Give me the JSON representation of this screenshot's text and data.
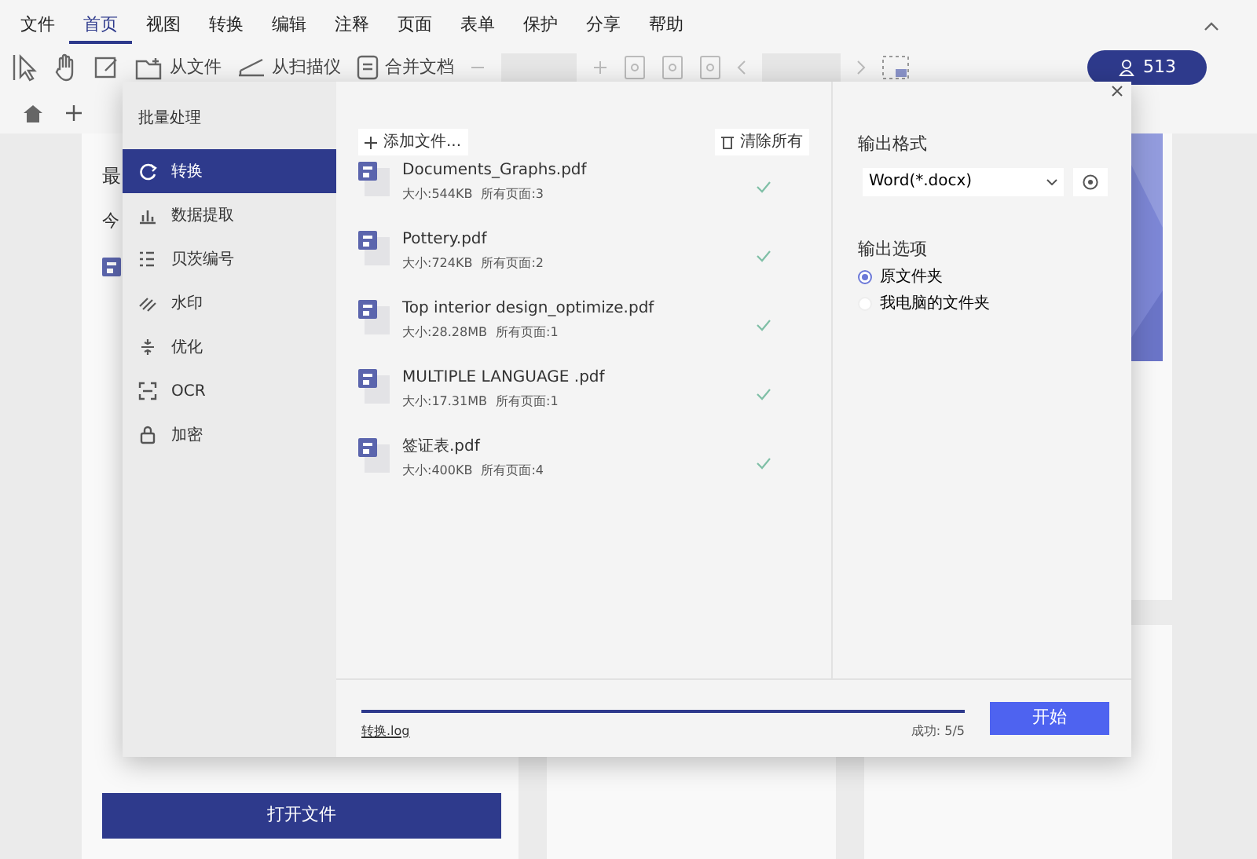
{
  "menu": [
    {
      "label": "文件",
      "selected": false
    },
    {
      "label": "首页",
      "selected": true
    },
    {
      "label": "视图",
      "selected": false
    },
    {
      "label": "转换",
      "selected": false
    },
    {
      "label": "编辑",
      "selected": false
    },
    {
      "label": "注释",
      "selected": false
    },
    {
      "label": "页面",
      "selected": false
    },
    {
      "label": "表单",
      "selected": false
    },
    {
      "label": "保护",
      "selected": false
    },
    {
      "label": "分享",
      "selected": false
    },
    {
      "label": "帮助",
      "selected": false
    }
  ],
  "toolbar": {
    "from_file": "从文件",
    "from_scanner": "从扫描仪",
    "combine": "合并文档",
    "user_count": "513"
  },
  "home": {
    "title_fragment": "最",
    "subtitle_fragment": "今",
    "open_button": "打开文件"
  },
  "dialog": {
    "title": "批量处理",
    "sidebar": [
      {
        "label": "转换",
        "selected": true
      },
      {
        "label": "数据提取",
        "selected": false
      },
      {
        "label": "贝茨编号",
        "selected": false
      },
      {
        "label": "水印",
        "selected": false
      },
      {
        "label": "优化",
        "selected": false
      },
      {
        "label": "OCR",
        "selected": false
      },
      {
        "label": "加密",
        "selected": false
      }
    ],
    "add_files": "添加文件...",
    "clear_all": "清除所有",
    "files": [
      {
        "name": "Documents_Graphs.pdf",
        "size": "大小:544KB",
        "pages": "所有页面:3",
        "done": true
      },
      {
        "name": "Pottery.pdf",
        "size": "大小:724KB",
        "pages": "所有页面:2",
        "done": true
      },
      {
        "name": "Top interior design_optimize.pdf",
        "size": "大小:28.28MB",
        "pages": "所有页面:1",
        "done": true
      },
      {
        "name": "MULTIPLE LANGUAGE .pdf",
        "size": "大小:17.31MB",
        "pages": "所有页面:1",
        "done": true
      },
      {
        "name": "签证表.pdf",
        "size": "大小:400KB",
        "pages": "所有页面:4",
        "done": true
      }
    ],
    "output_format_label": "输出格式",
    "output_format": "Word(*.docx)",
    "output_options_label": "输出选项",
    "output_options": [
      {
        "label": "原文件夹",
        "selected": true
      },
      {
        "label": "我电脑的文件夹",
        "selected": false
      }
    ],
    "progress": {
      "level": 1,
      "log": "转换.log",
      "status": "成功: 5/5"
    },
    "start_button": "开始"
  }
}
